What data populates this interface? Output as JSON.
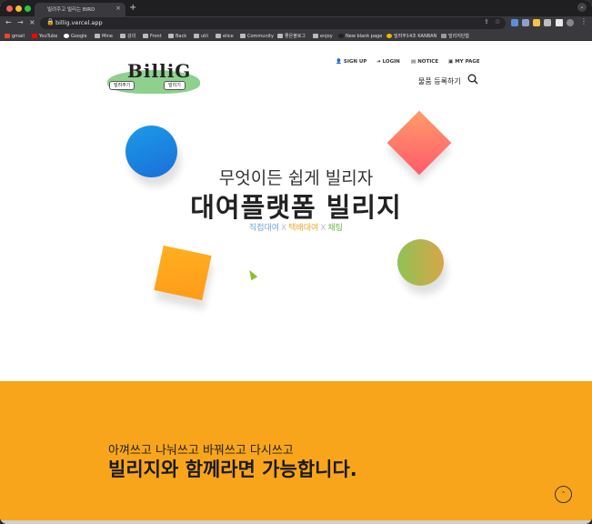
{
  "browser": {
    "tab_title": "빌려주고 빌리는 BIRD",
    "url": "billig.vercel.app",
    "bookmarks": [
      "gmail",
      "YouTube",
      "Google",
      "Mine",
      "강의",
      "Front",
      "Back",
      "util",
      "elice",
      "Community",
      "좋은블로그",
      "enjoy",
      "New blank page",
      "빌려주14조 KANBAN",
      "빌리지단합"
    ]
  },
  "header": {
    "logo_text": "BilliG",
    "logo_tag_lend": "빌려주기",
    "logo_tag_borrow": "빌리기",
    "links": [
      "SIGN UP",
      "LOGIN",
      "NOTICE",
      "MY PAGE"
    ],
    "register_label": "물품 등록하기"
  },
  "hero": {
    "subtitle": "무엇이든 쉽게 빌리자",
    "title": "대여플랫폼 빌리지",
    "tags": [
      "직접대여",
      "택배대여",
      "채팅"
    ],
    "separator": "X"
  },
  "band": {
    "subtitle": "아껴쓰고 나눠쓰고 바꿔쓰고 다시쓰고",
    "title": "빌리지와 함께라면 가능합니다."
  },
  "colors": {
    "accent": "#f9a51b",
    "tag_direct": "#6aa8e0",
    "tag_delivery": "#f2a52a",
    "tag_chat": "#6bb54a"
  }
}
